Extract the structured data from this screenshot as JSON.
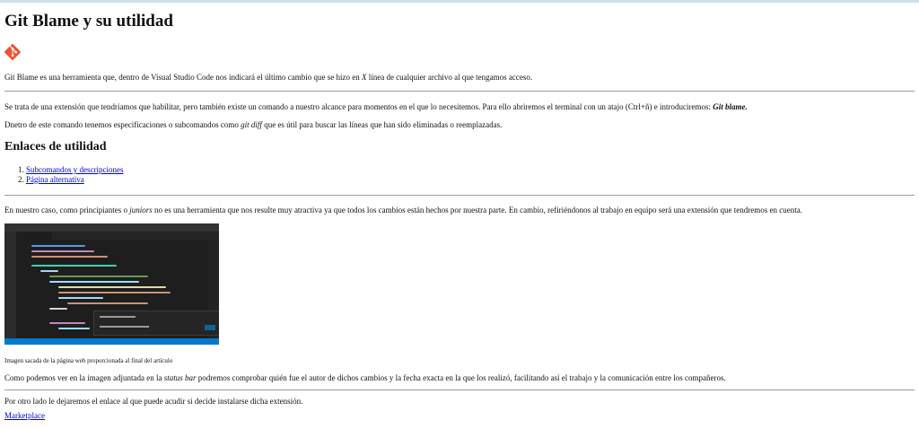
{
  "title": "Git Blame y su utilidad",
  "intro": {
    "before": "Git Blame es una herramienta que, dentro de Visual Studio Code nos indicará el último cambio que se hizo en ",
    "italic": "X",
    "after": " línea de cualquier archivo al que tengamos acceso."
  },
  "para2": {
    "before": "Se trata de una extensión que tendríamos que habilitar, pero también existe un comando a nuestro alcance para momentos en el que lo necesitemos. Para ello abriremos el terminal con un atajo (Ctrl+ñ) e introduciremos: ",
    "bold_italic": "Git blame."
  },
  "para3": {
    "before": "Dnetro de este comando tenemos especificaciones o subcomandos como ",
    "italic": "git diff",
    "after": " que es útil para buscar las líneas que han sido eliminadas o reemplazadas."
  },
  "links_section": {
    "heading": "Enlaces de utilidad",
    "items": [
      "Subcomandos y descripciones",
      "Página alternativa"
    ]
  },
  "para4": {
    "before": "En nuestro caso, como principiantes o ",
    "italic": "juniors",
    "after": " no es una herramienta que nos resulte muy atractiva ya que todos los cambios están hechos por nuestra parte. En cambio, refiriéndonos al trabajo en equipo será una extensión que tendremos en cuenta."
  },
  "image_caption": "Imagen sacada de la página web proporcionada al final del artículo",
  "para5": {
    "before": "Como podemos ver en la imagen adjuntada en la ",
    "italic": "status bar",
    "after": " podremos comprobar quién fue el autor de dichos cambios y la fecha exacta en la que los realizó, facilitando así el trabajo y la comunicación entre los compañeros."
  },
  "para6": "Por otro lado le dejaremos el enlace al que puede acudir si decide instalarse dicha extensión.",
  "marketplace_link": "Marketplace",
  "colors": {
    "git_logo": "#f05033",
    "link": "#0000ee",
    "vscode_bg": "#1e1e1e",
    "vscode_status": "#007acc"
  },
  "icons": [
    "git-logo-icon"
  ]
}
